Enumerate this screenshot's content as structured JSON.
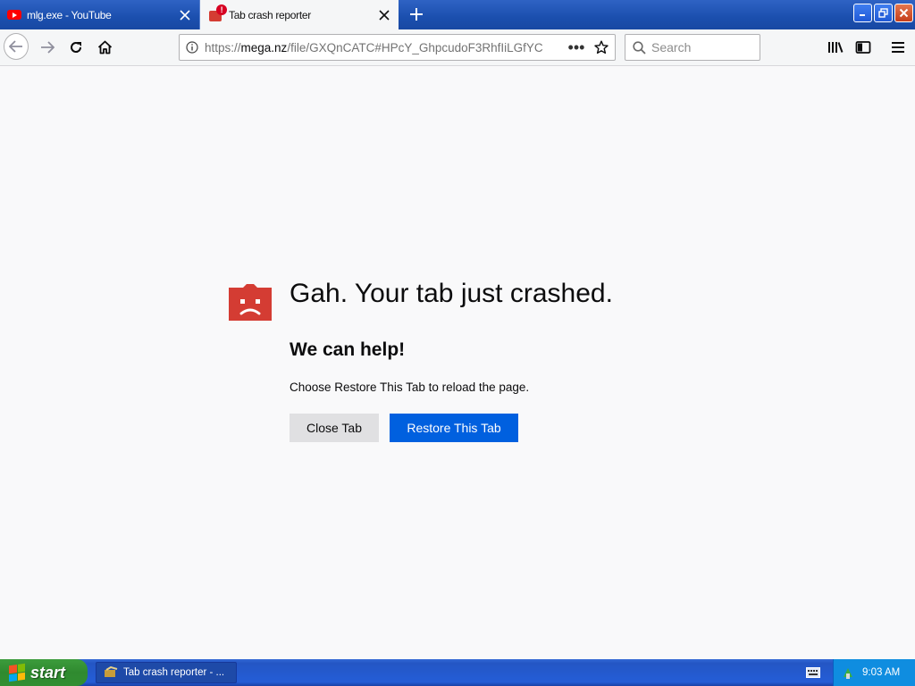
{
  "tabs": [
    {
      "title": "mlg.exe - YouTube",
      "active": false,
      "icon": "youtube-icon"
    },
    {
      "title": "Tab crash reporter",
      "active": true,
      "icon": "crash-icon",
      "badge": "!"
    }
  ],
  "toolbar": {
    "url_prefix": "https://",
    "url_host": "mega.nz",
    "url_path": "/file/GXQnCATC#HPcY_GhpcudoF3RhfIiLGfYC",
    "page_actions": "•••",
    "search_placeholder": "Search"
  },
  "crash": {
    "title": "Gah. Your tab just crashed.",
    "subtitle": "We can help!",
    "description": "Choose Restore This Tab to reload the page.",
    "close_label": "Close Tab",
    "restore_label": "Restore This Tab"
  },
  "taskbar": {
    "start_label": "start",
    "item_label": "Tab crash reporter - ...",
    "clock": "9:03 AM"
  },
  "colors": {
    "accent": "#0060df",
    "crash_red": "#d43c33",
    "xp_blue": "#245dd7",
    "xp_green": "#3c9c3c"
  }
}
